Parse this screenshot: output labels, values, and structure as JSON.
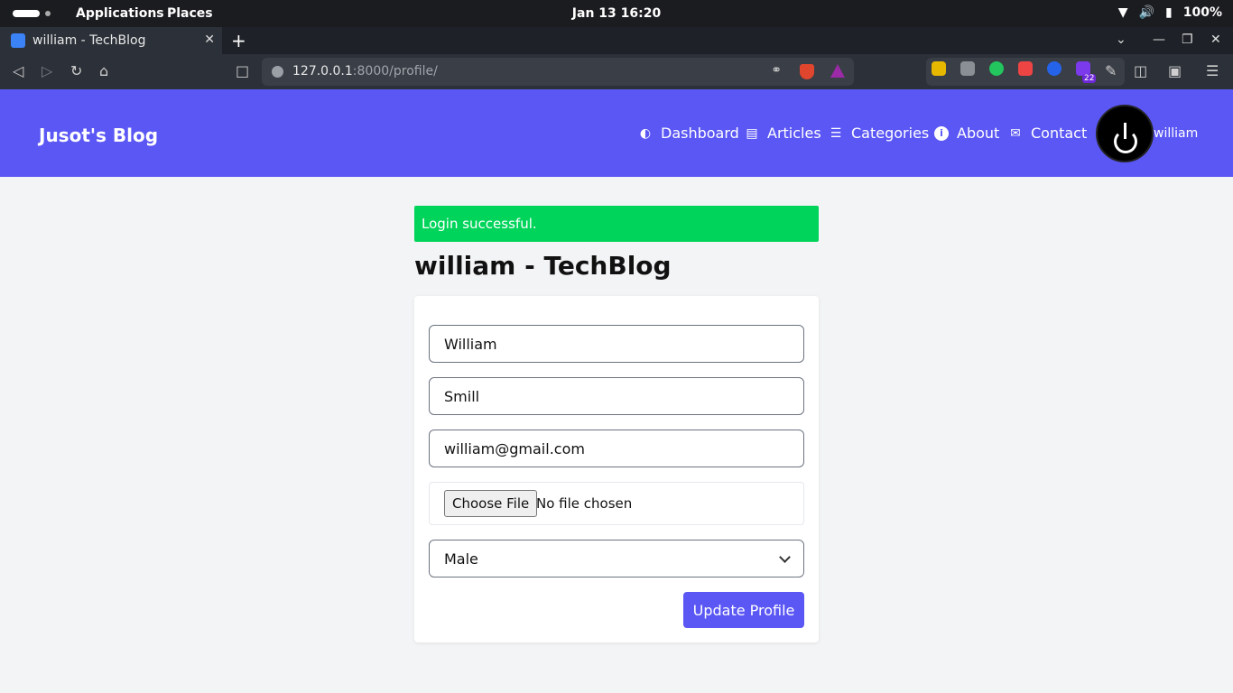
{
  "system_bar": {
    "menus": [
      "Applications",
      "Places"
    ],
    "clock": "Jan 13  16:20",
    "battery": "100%"
  },
  "browser": {
    "tab_title": "william - TechBlog",
    "url_host": "127.0.0.1",
    "url_rest": ":8000/profile/",
    "extension_badge": "22"
  },
  "site": {
    "brand": "Jusot's Blog",
    "nav": [
      {
        "label": "Dashboard",
        "icon": "dashboard-icon"
      },
      {
        "label": "Articles",
        "icon": "newspaper-icon"
      },
      {
        "label": "Categories",
        "icon": "list-icon"
      },
      {
        "label": "About",
        "icon": "info-icon"
      },
      {
        "label": "Contact",
        "icon": "envelope-icon"
      }
    ],
    "username": "william"
  },
  "main": {
    "alert": "Login successful.",
    "title": "william - TechBlog",
    "form": {
      "first_name": "William",
      "last_name": "Smill",
      "email": "william@gmail.com",
      "file_button": "Choose File",
      "file_status": "No file chosen",
      "gender": "Male",
      "submit": "Update Profile"
    }
  },
  "colors": {
    "brand": "#5b57f5",
    "success": "#00d45a"
  }
}
